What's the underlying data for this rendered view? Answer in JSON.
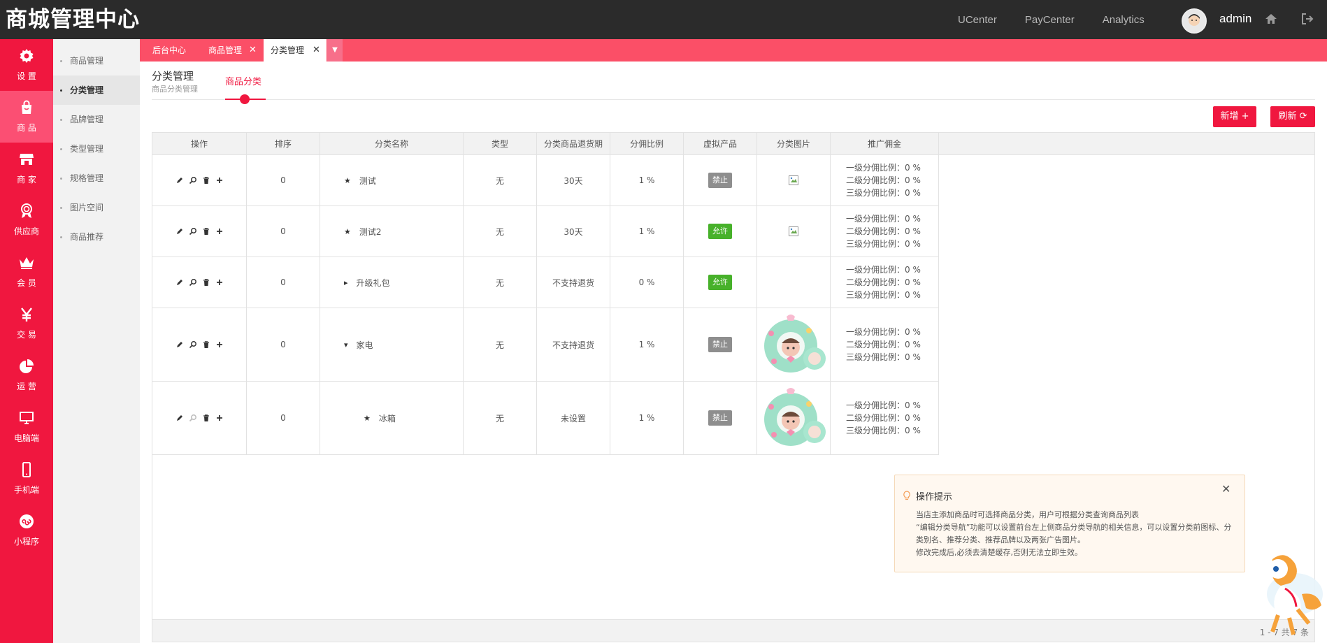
{
  "brand": "商城管理中心",
  "topnav": [
    "UCenter",
    "PayCenter",
    "Analytics"
  ],
  "user": {
    "name": "admin"
  },
  "leftnav": [
    {
      "label": "设 置",
      "icon": "gear-icon"
    },
    {
      "label": "商 品",
      "icon": "shopping-bag-icon",
      "active": true
    },
    {
      "label": "商 家",
      "icon": "store-icon"
    },
    {
      "label": "供应商",
      "icon": "award-icon"
    },
    {
      "label": "会 员",
      "icon": "crown-icon"
    },
    {
      "label": "交 易",
      "icon": "yen-icon"
    },
    {
      "label": "运 营",
      "icon": "pie-chart-icon"
    },
    {
      "label": "电脑端",
      "icon": "monitor-icon"
    },
    {
      "label": "手机端",
      "icon": "phone-icon"
    },
    {
      "label": "小程序",
      "icon": "mini-program-icon"
    }
  ],
  "subnav": [
    "商品管理",
    "分类管理",
    "品牌管理",
    "类型管理",
    "规格管理",
    "图片空间",
    "商品推荐"
  ],
  "tabs": [
    "后台中心",
    "商品管理",
    "分类管理"
  ],
  "header": {
    "title": "分类管理",
    "subtitle": "商品分类管理",
    "tab": "商品分类"
  },
  "buttons": {
    "add": "新增 +",
    "refresh": "刷新 ⟳"
  },
  "table": {
    "columns": [
      "操作",
      "排序",
      "分类名称",
      "类型",
      "分类商品退货期",
      "分佣比例",
      "虚拟产品",
      "分类图片",
      "推广佣金"
    ],
    "rows": [
      {
        "sort": "0",
        "name": "测试",
        "prefix": "★",
        "type": "无",
        "return": "30天",
        "ratio": "1 %",
        "virtual": "禁止",
        "virtual_status": "deny",
        "image": "broken",
        "commission": [
          "一级分佣比例：0 %",
          "二级分佣比例：0 %",
          "三级分佣比例：0 %"
        ]
      },
      {
        "sort": "0",
        "name": "测试2",
        "prefix": "★",
        "type": "无",
        "return": "30天",
        "ratio": "1 %",
        "virtual": "允许",
        "virtual_status": "allow",
        "image": "broken",
        "commission": [
          "一级分佣比例：0 %",
          "二级分佣比例：0 %",
          "三级分佣比例：0 %"
        ]
      },
      {
        "sort": "0",
        "name": "升级礼包",
        "prefix": "▸",
        "type": "无",
        "return": "不支持退货",
        "ratio": "0 %",
        "virtual": "允许",
        "virtual_status": "allow",
        "image": "none",
        "commission": [
          "一级分佣比例：0 %",
          "二级分佣比例：0 %",
          "三级分佣比例：0 %"
        ]
      },
      {
        "sort": "0",
        "name": "家电",
        "prefix": "▾",
        "type": "无",
        "return": "不支持退货",
        "ratio": "1 %",
        "virtual": "禁止",
        "virtual_status": "deny",
        "image": "wreath",
        "commission": [
          "一级分佣比例：0 %",
          "二级分佣比例：0 %",
          "三级分佣比例：0 %"
        ]
      },
      {
        "sort": "0",
        "name": "冰箱",
        "prefix": "★",
        "type": "无",
        "return": "未设置",
        "ratio": "1 %",
        "virtual": "禁止",
        "virtual_status": "deny",
        "image": "wreath",
        "commission": [
          "一级分佣比例：0 %",
          "二级分佣比例：0 %",
          "三级分佣比例：0 %"
        ]
      }
    ]
  },
  "pager": "1 - 7 共 7 条",
  "tips": {
    "title": "操作提示",
    "lines": [
      "当店主添加商品时可选择商品分类，用户可根据分类查询商品列表",
      "“编辑分类导航”功能可以设置前台左上侧商品分类导航的相关信息，可以设置分类前图标、分类别名、推荐分类、推荐品牌以及两张广告图片。",
      "修改完成后,必须去清楚缓存,否则无法立即生效。"
    ]
  },
  "colors": {
    "accent": "#f0173f",
    "tabbar": "#fb4f67",
    "topbar": "#2b2b2b",
    "allow": "#47b12a",
    "deny": "#8e8e8e"
  }
}
